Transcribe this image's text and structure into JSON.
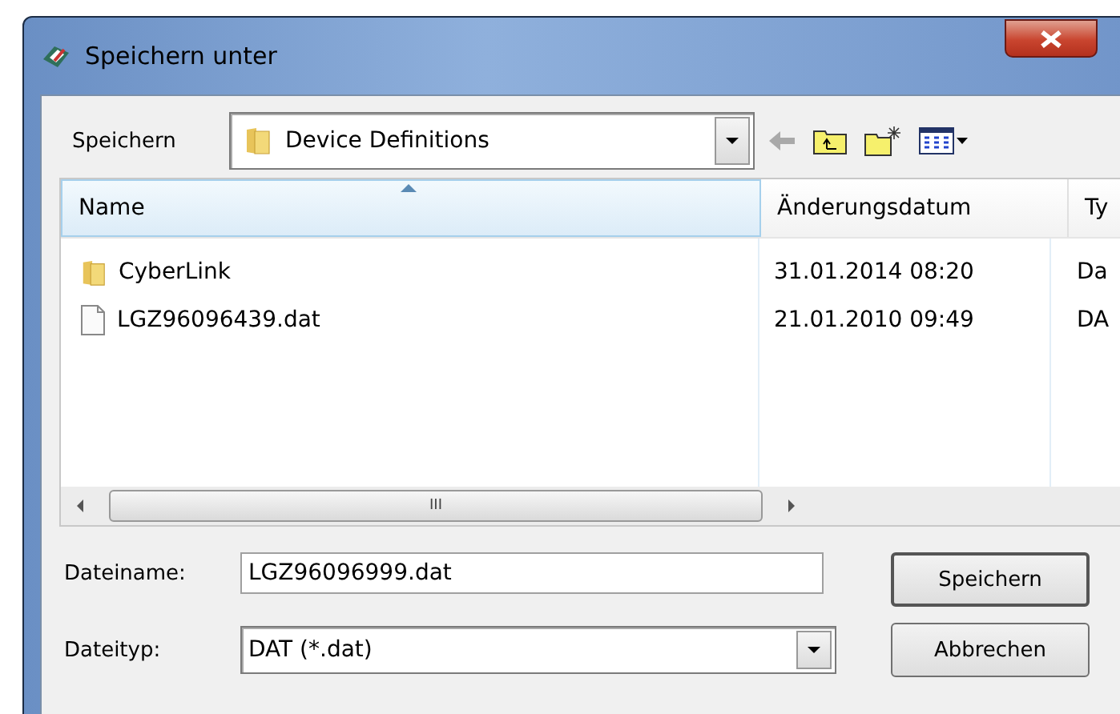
{
  "window": {
    "title": "Speichern unter"
  },
  "location": {
    "label": "Speichern",
    "value": "Device Definitions"
  },
  "table": {
    "columns": [
      {
        "label": "Name",
        "sorted": true
      },
      {
        "label": "Änderungsdatum",
        "sorted": false
      },
      {
        "label": "Ty",
        "sorted": false
      }
    ],
    "rows": [
      {
        "kind": "folder",
        "name": "CyberLink",
        "date": "31.01.2014 08:20",
        "column_3": "Da"
      },
      {
        "kind": "file",
        "name": "LGZ96096439.dat",
        "date": "21.01.2010 09:49",
        "column_3": "DA"
      }
    ],
    "scroll_thumb": "III"
  },
  "filename": {
    "label": "Dateiname:",
    "value": "LGZ96096999.dat"
  },
  "filetype": {
    "label": "Dateityp:",
    "value": "DAT (*.dat)"
  },
  "buttons": [
    "Speichern",
    "Abbrechen"
  ]
}
